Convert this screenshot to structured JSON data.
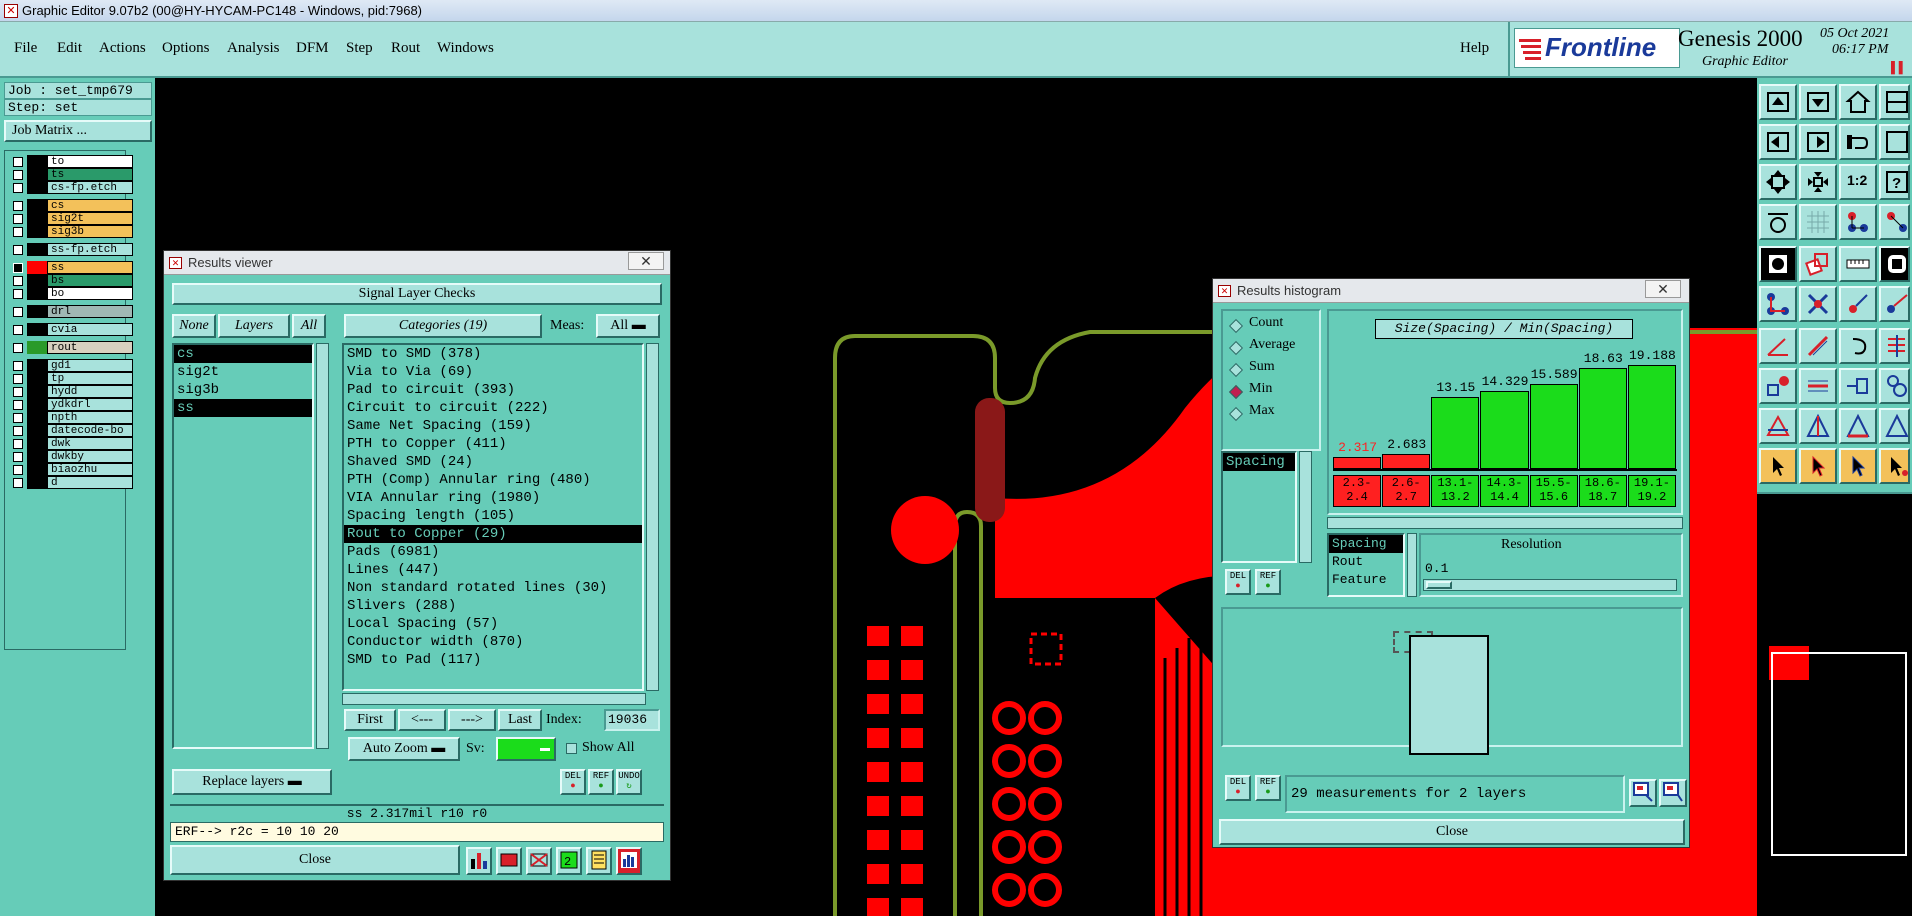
{
  "window": {
    "title": "Graphic Editor 9.07b2 (00@HY-HYCAM-PC148 - Windows, pid:7968)"
  },
  "menu": {
    "items": [
      "File",
      "Edit",
      "Actions",
      "Options",
      "Analysis",
      "DFM",
      "Step",
      "Rout",
      "Windows"
    ],
    "help": "Help"
  },
  "brand": {
    "logo": "Frontline",
    "product": "Genesis 2000",
    "subtitle": "Graphic Editor",
    "date": "05 Oct 2021",
    "time": "06:17 PM"
  },
  "job": {
    "job_label": "Job : set_tmp679",
    "step_label": "Step: set",
    "matrix_button": "Job Matrix ..."
  },
  "layers": [
    {
      "name": "to",
      "color": "#ffffff",
      "checked": true
    },
    {
      "name": "ts",
      "color": "#2a9a6a",
      "checked": true
    },
    {
      "name": "cs-fp.etch",
      "color": "#a8e2dc",
      "checked": true
    },
    {
      "name": "cs",
      "color": "#f3c15a",
      "checked": true
    },
    {
      "name": "sig2t",
      "color": "#f3c15a",
      "checked": true
    },
    {
      "name": "sig3b",
      "color": "#f3c15a",
      "checked": true
    },
    {
      "name": "ss-fp.etch",
      "color": "#a8e2dc",
      "checked": true
    },
    {
      "name": "ss",
      "color": "#f3c15a",
      "checked": false,
      "swatch": "#ff0000"
    },
    {
      "name": "bs",
      "color": "#2a9a6a",
      "checked": true
    },
    {
      "name": "bo",
      "color": "#ffffff",
      "checked": true
    },
    {
      "name": "drl",
      "color": "#a0b8b4",
      "checked": true
    },
    {
      "name": "cvia",
      "color": "#a8e2dc",
      "checked": true
    },
    {
      "name": "rout",
      "color": "#d8d0c0",
      "checked": true,
      "swatch": "#2a9a2a"
    },
    {
      "name": "gd1",
      "color": "#a8e2dc",
      "checked": true
    },
    {
      "name": "tp",
      "color": "#a8e2dc",
      "checked": true
    },
    {
      "name": "hydd",
      "color": "#a8e2dc",
      "checked": true
    },
    {
      "name": "ydkdrl",
      "color": "#a8e2dc",
      "checked": true
    },
    {
      "name": "npth",
      "color": "#a8e2dc",
      "checked": true
    },
    {
      "name": "datecode-bo",
      "color": "#a8e2dc",
      "checked": true
    },
    {
      "name": "dwk",
      "color": "#a8e2dc",
      "checked": true
    },
    {
      "name": "dwkby",
      "color": "#a8e2dc",
      "checked": true
    },
    {
      "name": "biaozhu",
      "color": "#a8e2dc",
      "checked": true
    },
    {
      "name": "d",
      "color": "#a8e2dc",
      "checked": true
    }
  ],
  "results_viewer": {
    "title": "Results viewer",
    "header": "Signal Layer Checks",
    "none_label": "None",
    "layers_label": "Layers",
    "all_label": "All",
    "categories_label": "Categories (19)",
    "meas_label": "Meas:",
    "meas_value": "All",
    "layer_list": [
      {
        "name": "cs",
        "selected": true
      },
      {
        "name": "sig2t",
        "selected": false
      },
      {
        "name": "sig3b",
        "selected": false
      },
      {
        "name": "ss",
        "selected": true
      }
    ],
    "categories": [
      {
        "label": "SMD to SMD (378)",
        "selected": false
      },
      {
        "label": "Via to Via (69)",
        "selected": false
      },
      {
        "label": "Pad to circuit (393)",
        "selected": false
      },
      {
        "label": "Circuit to circuit (222)",
        "selected": false
      },
      {
        "label": "Same Net Spacing (159)",
        "selected": false
      },
      {
        "label": "PTH to Copper (411)",
        "selected": false
      },
      {
        "label": "Shaved SMD (24)",
        "selected": false
      },
      {
        "label": "PTH (Comp) Annular ring (480)",
        "selected": false
      },
      {
        "label": "VIA Annular ring (1980)",
        "selected": false
      },
      {
        "label": "Spacing length (105)",
        "selected": false
      },
      {
        "label": "Rout to Copper (29)",
        "selected": true
      },
      {
        "label": "Pads (6981)",
        "selected": false
      },
      {
        "label": "Lines (447)",
        "selected": false
      },
      {
        "label": "Non standard rotated lines (30)",
        "selected": false
      },
      {
        "label": "Slivers (288)",
        "selected": false
      },
      {
        "label": "Local Spacing (57)",
        "selected": false
      },
      {
        "label": "Conductor width (870)",
        "selected": false
      },
      {
        "label": "SMD to Pad (117)",
        "selected": false
      }
    ],
    "nav": {
      "first": "First",
      "prev": "<---",
      "next": "--->",
      "last": "Last",
      "index_label": "Index:",
      "index_value": "19036"
    },
    "auto_zoom": "Auto Zoom",
    "sv_label": "Sv:",
    "show_all": "Show All",
    "replace_layers": "Replace layers",
    "icons": {
      "del": "DEL",
      "ref": "REF",
      "undo": "UNDO"
    },
    "status": "ss 2.317mil  r10  r0",
    "erf": "ERF--> r2c = 10 10 20",
    "close": "Close"
  },
  "histogram": {
    "title": "Results histogram",
    "modes": [
      {
        "label": "Count",
        "on": false
      },
      {
        "label": "Average",
        "on": false
      },
      {
        "label": "Sum",
        "on": false
      },
      {
        "label": "Min",
        "on": true
      },
      {
        "label": "Max",
        "on": false
      }
    ],
    "chart_title": "Size(Spacing) / Min(Spacing)",
    "bins": [
      {
        "value": "2.317",
        "range_a": "2.3-",
        "range_b": "2.4",
        "color": "#ff2020",
        "value_color": "#ff2020",
        "level": 0.12
      },
      {
        "value": "2.683",
        "range_a": "2.6-",
        "range_b": "2.7",
        "color": "#ff2020",
        "value_color": "#000000",
        "level": 0.14
      },
      {
        "value": "13.15",
        "range_a": "13.1-",
        "range_b": "13.2",
        "color": "#1bdc1b",
        "value_color": "#000000",
        "level": 0.69
      },
      {
        "value": "14.329",
        "range_a": "14.3-",
        "range_b": "14.4",
        "color": "#1bdc1b",
        "value_color": "#000000",
        "level": 0.75
      },
      {
        "value": "15.589",
        "range_a": "15.5-",
        "range_b": "15.6",
        "color": "#1bdc1b",
        "value_color": "#000000",
        "level": 0.82
      },
      {
        "value": "18.63",
        "range_a": "18.6-",
        "range_b": "18.7",
        "color": "#1bdc1b",
        "value_color": "#000000",
        "level": 0.97
      },
      {
        "value": "19.188",
        "range_a": "19.1-",
        "range_b": "19.2",
        "color": "#1bdc1b",
        "value_color": "#000000",
        "level": 1.0
      }
    ],
    "attr_list": [
      "Spacing"
    ],
    "attr_list2": [
      {
        "label": "Spacing",
        "selected": true
      },
      {
        "label": "Rout",
        "selected": false
      },
      {
        "label": "Feature",
        "selected": false
      }
    ],
    "resolution_label": "Resolution",
    "resolution_value": "0.1",
    "icons": {
      "del": "DEL",
      "ref": "REF"
    },
    "measurements": "29 measurements for 2 layers",
    "close": "Close"
  },
  "colors": {
    "panel": "#66ccb8",
    "panel_light": "#a8e2dc",
    "copper": "#ff0000",
    "rout": "#7a9a2a"
  }
}
